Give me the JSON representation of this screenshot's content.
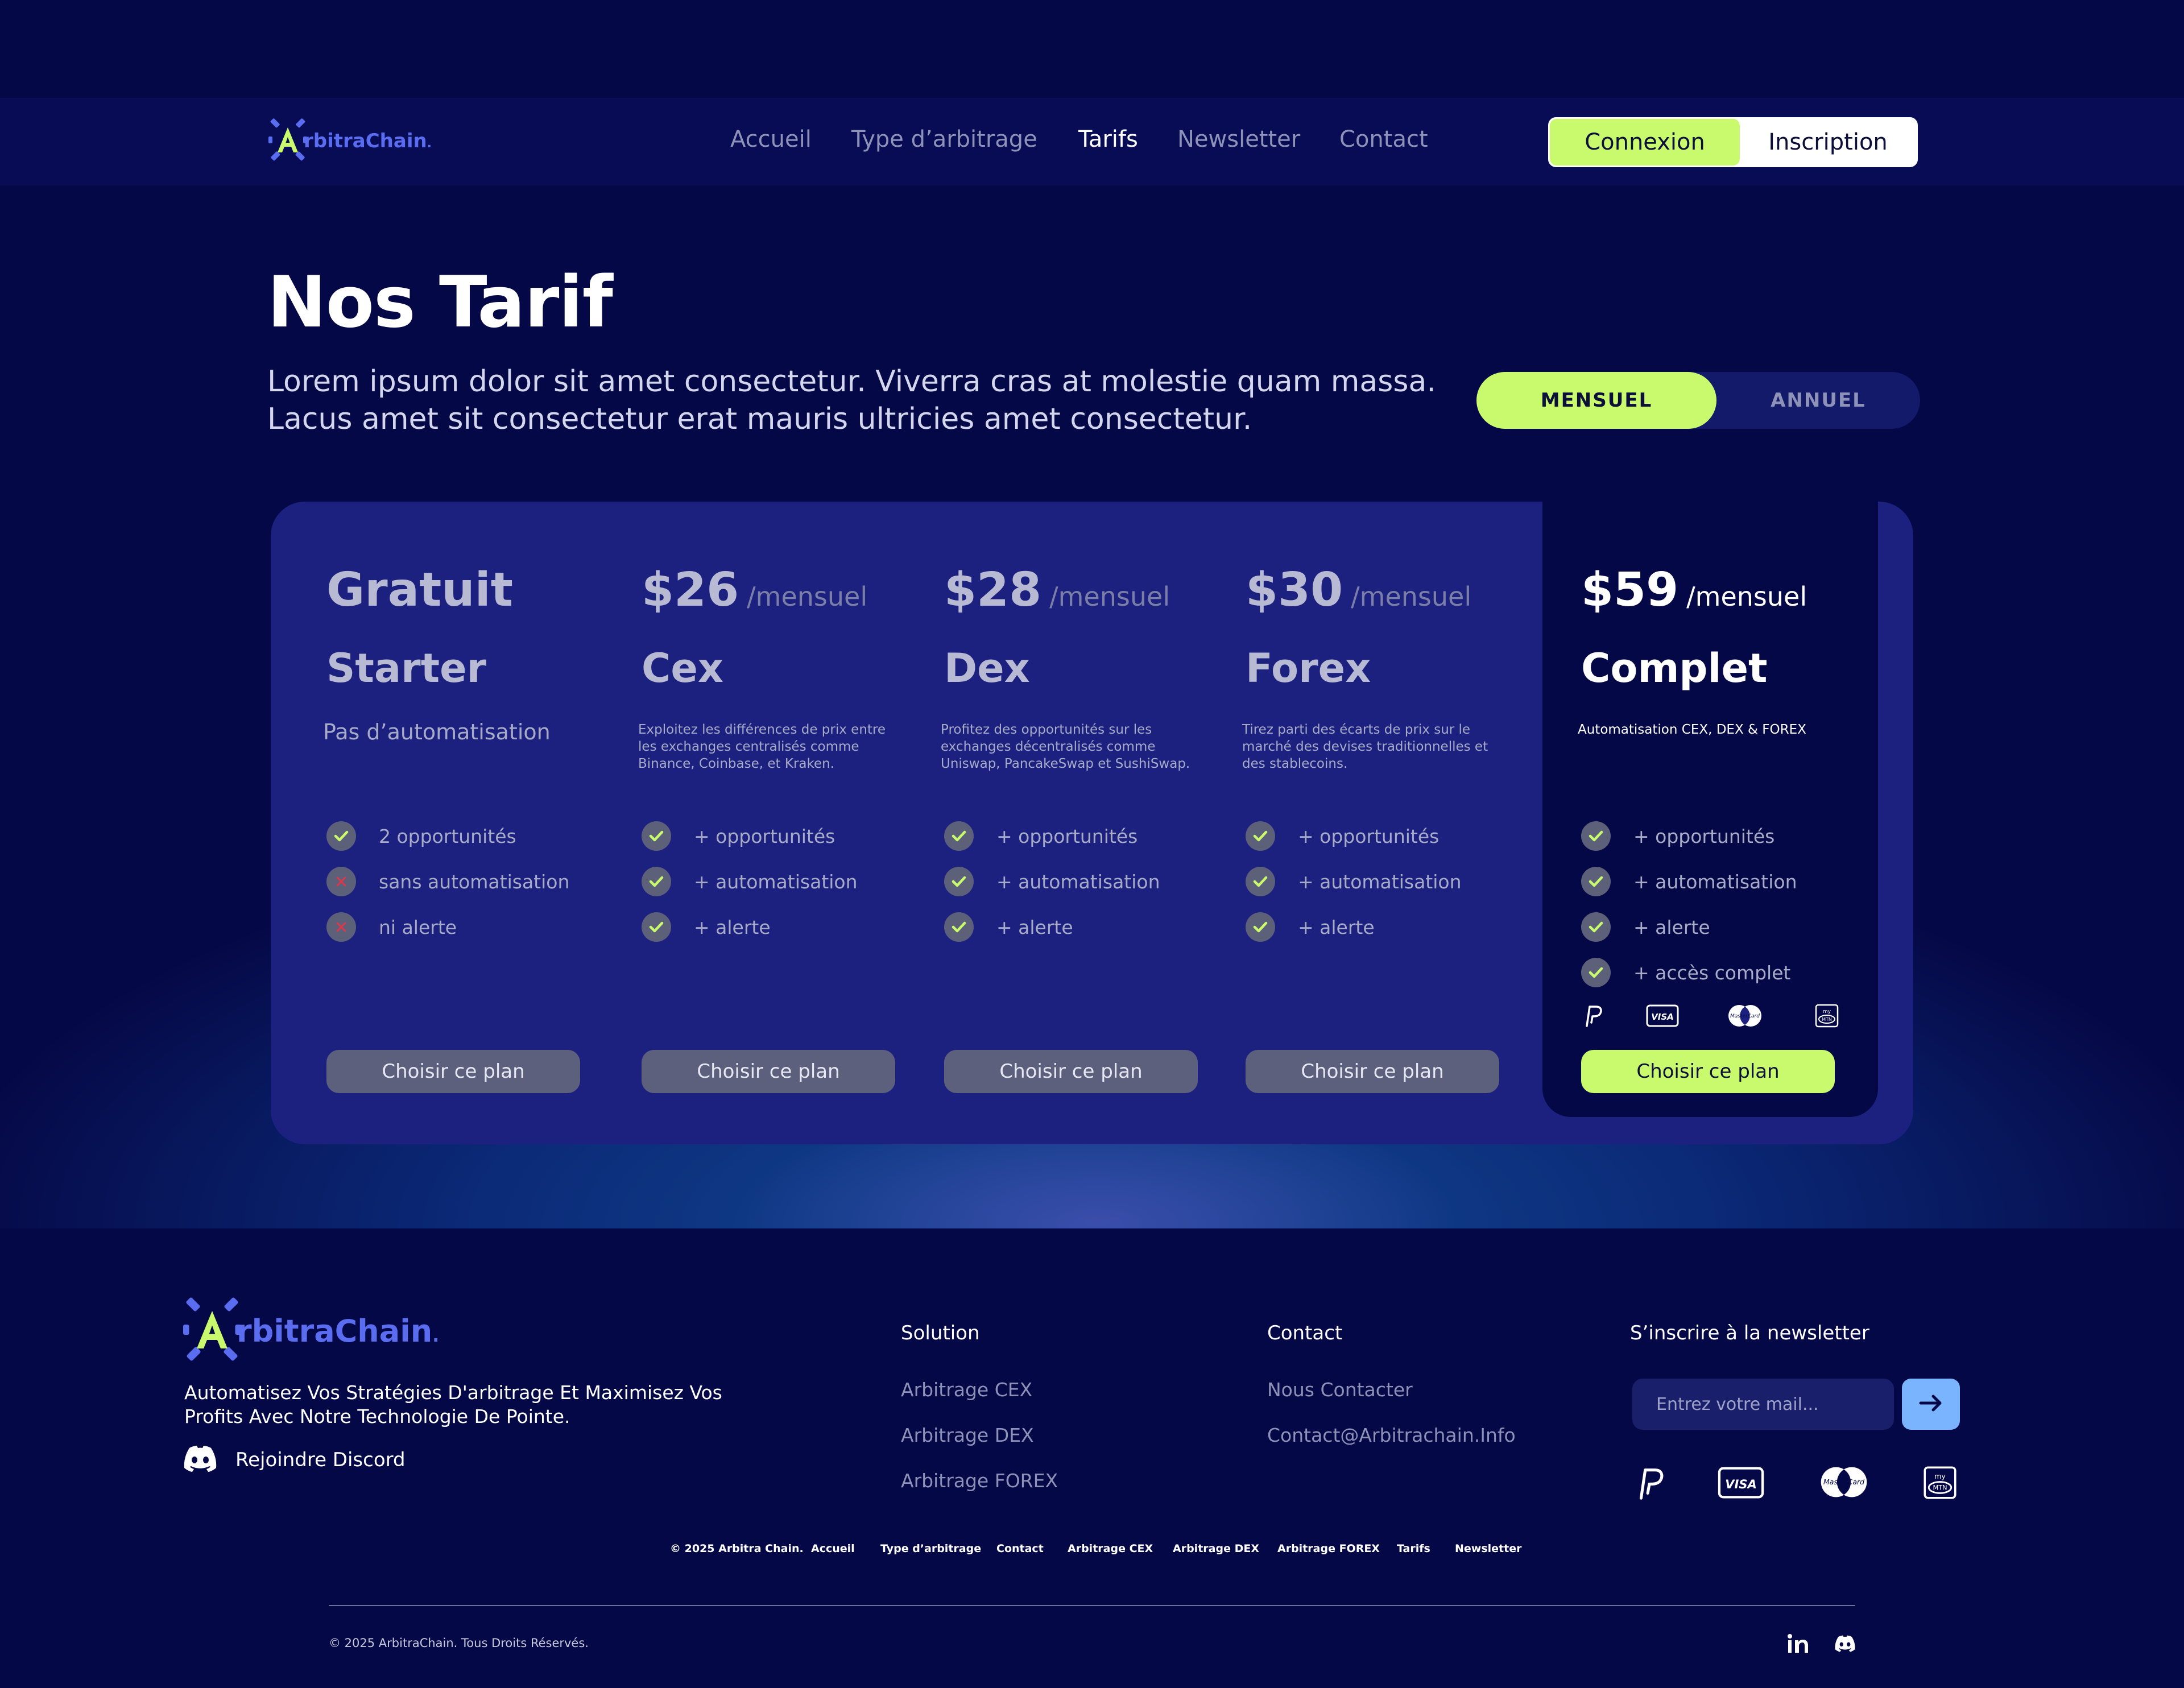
{
  "brand": {
    "name_first": "A",
    "name_rest": "rbitraChain",
    "dot": "."
  },
  "nav": {
    "links": [
      "Accueil",
      "Type d’arbitrage",
      "Tarifs",
      "Newsletter",
      "Contact"
    ],
    "active": "Tarifs",
    "login": "Connexion",
    "signup": "Inscription"
  },
  "hero": {
    "title": "Nos Tarif",
    "subtitle_line1": "Lorem ipsum dolor sit amet consectetur. Viverra cras at molestie quam massa.",
    "subtitle_line2": "Lacus amet sit consectetur erat mauris ultricies amet consectetur."
  },
  "billing": {
    "monthly": "MENSUEL",
    "yearly": "ANNUEL",
    "selected": "MENSUEL"
  },
  "plans": [
    {
      "price": "Gratuit",
      "period": "",
      "name": "Starter",
      "description": "Pas d’automatisation",
      "features": [
        {
          "text": "2 opportunités",
          "included": true
        },
        {
          "text": "sans automatisation",
          "included": false
        },
        {
          "text": "ni alerte",
          "included": false
        }
      ],
      "cta": "Choisir ce plan"
    },
    {
      "price": "$26",
      "period": "/mensuel",
      "name": "Cex",
      "description": "Exploitez les différences de prix entre les exchanges centralisés comme Binance, Coinbase, et Kraken.",
      "features": [
        {
          "text": "+ opportunités",
          "included": true
        },
        {
          "text": "+ automatisation",
          "included": true
        },
        {
          "text": "+ alerte",
          "included": true
        }
      ],
      "cta": "Choisir ce plan"
    },
    {
      "price": "$28",
      "period": "/mensuel",
      "name": "Dex",
      "description": "Profitez des opportunités sur les exchanges décentralisés comme Uniswap, PancakeSwap et SushiSwap.",
      "features": [
        {
          "text": "+ opportunités",
          "included": true
        },
        {
          "text": "+ automatisation",
          "included": true
        },
        {
          "text": "+ alerte",
          "included": true
        }
      ],
      "cta": "Choisir ce plan"
    },
    {
      "price": "$30",
      "period": "/mensuel",
      "name": "Forex",
      "description": "Tirez parti des écarts de prix sur le marché des devises traditionnelles et des stablecoins.",
      "features": [
        {
          "text": "+ opportunités",
          "included": true
        },
        {
          "text": "+ automatisation",
          "included": true
        },
        {
          "text": "+ alerte",
          "included": true
        }
      ],
      "cta": "Choisir ce plan"
    },
    {
      "price": "$59",
      "period": "/mensuel",
      "name": "Complet",
      "description": "Automatisation CEX, DEX & FOREX",
      "features": [
        {
          "text": "+ opportunités",
          "included": true
        },
        {
          "text": "+ automatisation",
          "included": true
        },
        {
          "text": "+ alerte",
          "included": true
        },
        {
          "text": "+ accès complet",
          "included": true
        }
      ],
      "payment_icons": [
        "paypal-icon",
        "visa-icon",
        "mastercard-icon",
        "mtn-momo-icon"
      ],
      "cta": "Choisir ce plan"
    }
  ],
  "footer": {
    "tagline": "Automatisez Vos Stratégies D'arbitrage Et Maximisez Vos Profits Avec Notre Technologie De Pointe.",
    "discord": "Rejoindre Discord",
    "solution": {
      "title": "Solution",
      "links": [
        "Arbitrage CEX",
        "Arbitrage DEX",
        "Arbitrage FOREX"
      ]
    },
    "contact": {
      "title": "Contact",
      "links": [
        "Nous Contacter",
        "Contact@Arbitrachain.Info"
      ]
    },
    "newsletter": {
      "title": "S’inscrire à la newsletter",
      "placeholder": "Entrez votre mail..."
    },
    "payment_icons": [
      "paypal-icon",
      "visa-icon",
      "mastercard-icon",
      "mtn-momo-icon"
    ],
    "bottom_links": [
      "© 2025 Arbitra Chain.",
      "Accueil",
      "Type d’arbitrage",
      "Contact",
      "Arbitrage CEX",
      "Arbitrage DEX",
      "Arbitrage FOREX",
      "Tarifs",
      "Newsletter"
    ],
    "copyright": "© 2025 ArbitraChain. Tous Droits Réservés.",
    "social": [
      "linkedin-icon",
      "discord-icon"
    ]
  },
  "colors": {
    "accent": "#c9fa6d",
    "brand": "#5a6cf0",
    "background": "#050846",
    "panel": "#1c2180",
    "button_muted": "#5d607c"
  }
}
